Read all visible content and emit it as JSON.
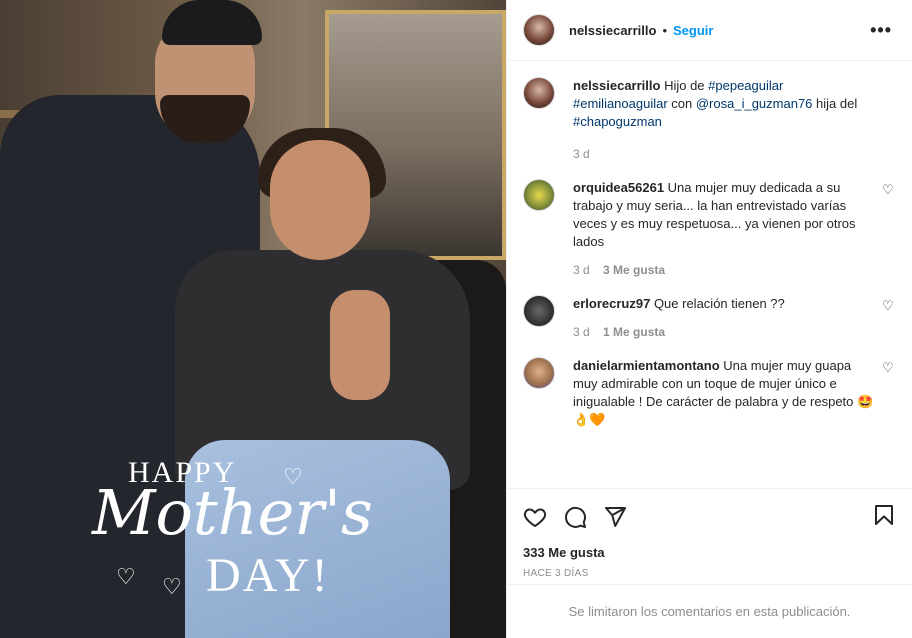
{
  "photo": {
    "overlay_happy": "HAPPY",
    "overlay_mothers": "Mother's",
    "overlay_day": "DAY!"
  },
  "header": {
    "username": "nelssiecarrillo",
    "separator": "•",
    "follow_label": "Seguir",
    "more_label": "•••"
  },
  "caption": {
    "username": "nelssiecarrillo",
    "text_1": " Hijo de ",
    "tag_1": "#pepeaguilar",
    "tag_2": "#emilianoaguilar",
    "text_2": " con ",
    "tag_3": "@rosa_i_guzman76",
    "text_3": " hija del ",
    "tag_4": "#chapoguzman",
    "time": "3 d"
  },
  "comments": [
    {
      "username": "orquidea56261",
      "text": " Una mujer muy dedicada a su trabajo y muy seria... la han entrevistado varías veces y es muy respetuosa... ya vienen por otros lados",
      "time": "3 d",
      "likes": "3 Me gusta"
    },
    {
      "username": "erlorecruz97",
      "text": " Que relación tienen ??",
      "time": "3 d",
      "likes": "1 Me gusta"
    },
    {
      "username": "danielarmientamontano",
      "text": " Una mujer muy guapa muy admirable con un toque de mujer único e inigualable ! De carácter de palabra y de respeto 🤩👌🧡",
      "time": "",
      "likes": ""
    }
  ],
  "actions": {
    "likes_count": "333 Me gusta",
    "posted_time": "HACE 3 DÍAS"
  },
  "footer": {
    "limited_text": "Se limitaron los comentarios en esta publicación."
  },
  "colors": {
    "link_blue": "#0095f6",
    "tag_blue": "#00376b",
    "muted": "#8e8e8e",
    "border": "#efefef"
  }
}
